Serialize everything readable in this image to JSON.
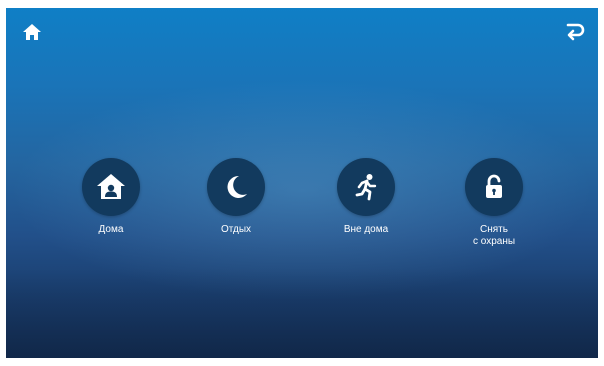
{
  "header": {
    "home_icon": "home-icon",
    "back_icon": "return-arrow-icon"
  },
  "modes": [
    {
      "label": "Дома",
      "icon": "home-shield-icon"
    },
    {
      "label": "Отдых",
      "icon": "moon-icon"
    },
    {
      "label": "Вне дома",
      "icon": "running-person-icon"
    },
    {
      "label": "Снять\nс охраны",
      "icon": "unlocked-padlock-icon"
    }
  ],
  "colors": {
    "background_top": "#0f7fc6",
    "background_bottom": "#142f55",
    "button_circle": "#123a5e",
    "foreground": "#ffffff"
  }
}
